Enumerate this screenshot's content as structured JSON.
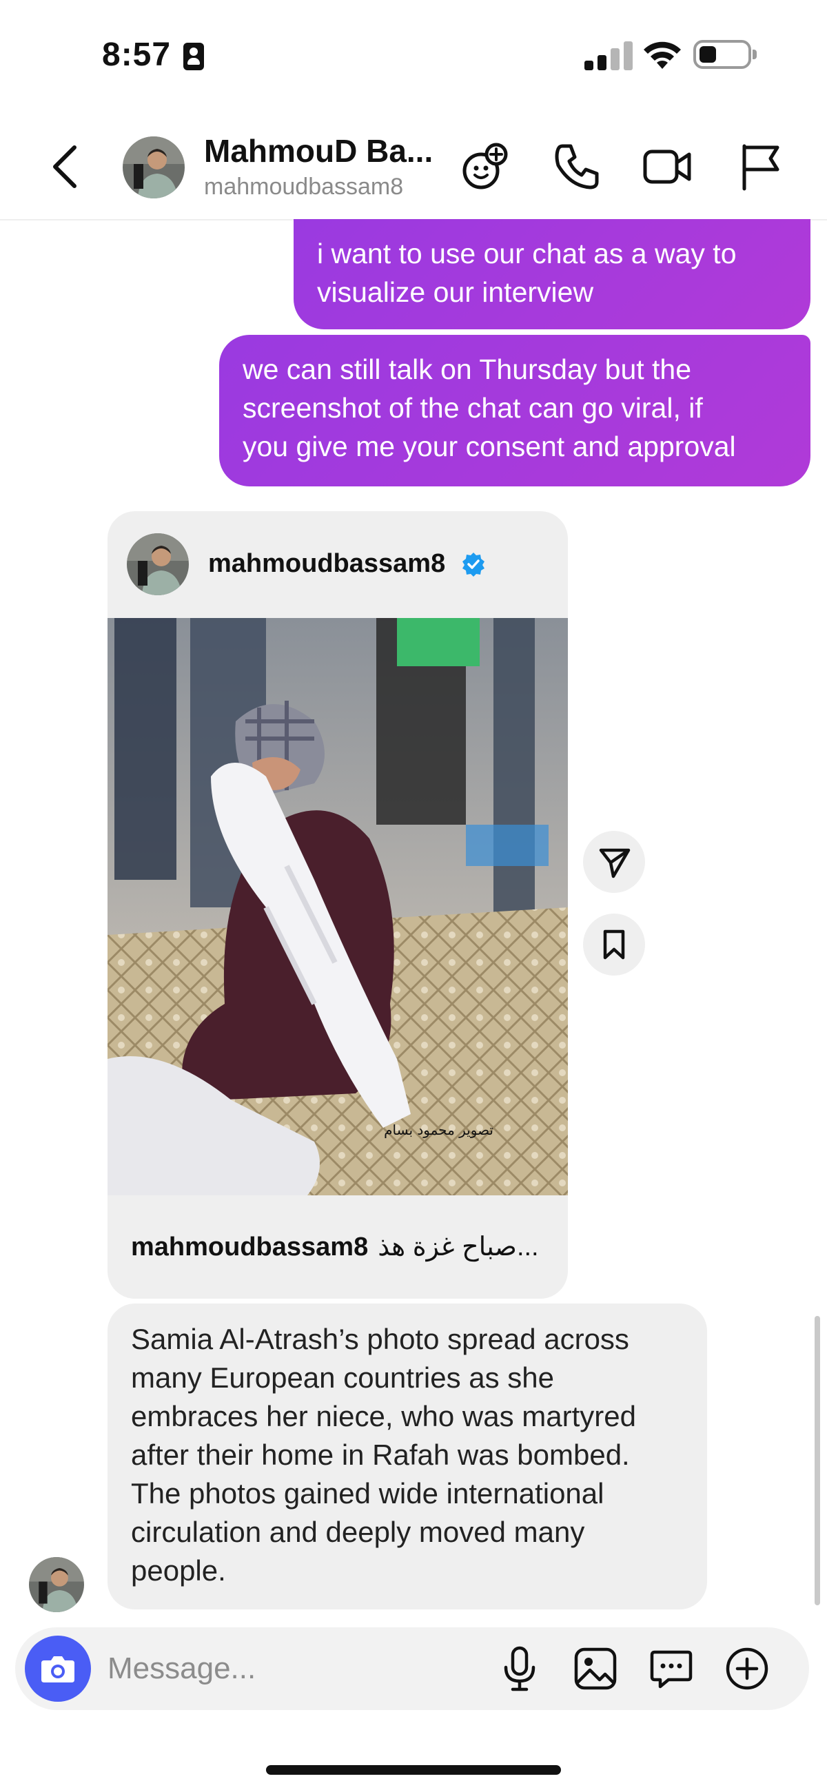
{
  "status_bar": {
    "time": "8:57"
  },
  "header": {
    "name": "MahmouD Ba...",
    "username": "mahmoudbassam8",
    "icons": [
      "back-icon",
      "effects-icon",
      "phone-icon",
      "video-icon",
      "flag-icon"
    ]
  },
  "messages": {
    "outgoing": [
      {
        "lines": [
          "i want to use our chat as a way to",
          "visualize our interview"
        ]
      },
      {
        "lines": [
          "we can still talk on Thursday but the",
          "screenshot of the chat can go viral, if",
          "you give me your consent and approval"
        ]
      }
    ],
    "shared_post": {
      "username": "mahmoudbassam8",
      "verified": true,
      "image_watermark": "تصوير محمود بسام",
      "caption_user": "mahmoudbassam8",
      "caption_text": "صباح غزة هذ..."
    },
    "incoming": {
      "lines": [
        "Samia Al-Atrash’s photo spread across",
        "many European countries as she",
        "embraces her niece, who was martyred",
        "after their home in Rafah was bombed.",
        "The photos gained wide international",
        "circulation and deeply moved many",
        "people."
      ]
    }
  },
  "composer": {
    "placeholder": "Message...",
    "icons": [
      "camera-icon",
      "microphone-icon",
      "image-icon",
      "sticker-icon",
      "plus-icon"
    ]
  },
  "colors": {
    "outgoing_bubble": "#a23ae0",
    "incoming_bubble": "#efefef",
    "camera_button": "#4a5df5",
    "verified_badge": "#1d9bf0"
  }
}
